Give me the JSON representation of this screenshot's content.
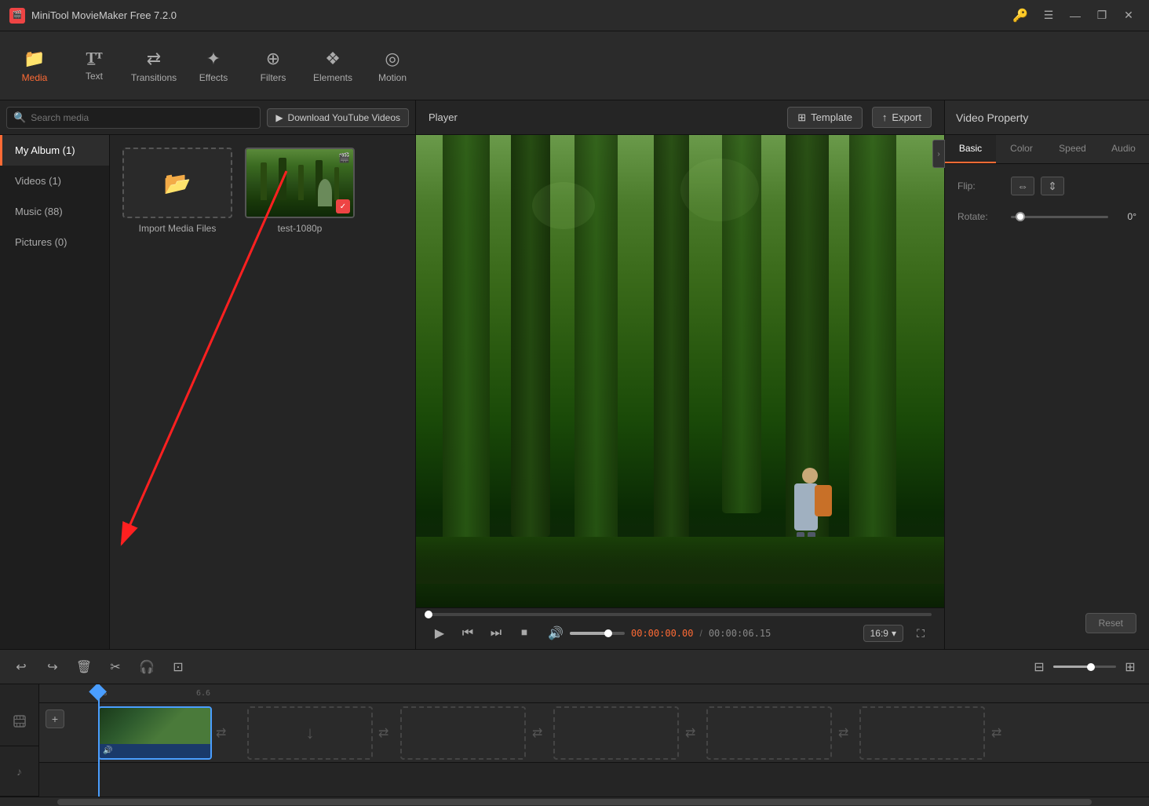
{
  "app": {
    "title": "MiniTool MovieMaker Free 7.2.0",
    "icon_label": "M"
  },
  "titlebar": {
    "title": "MiniTool MovieMaker Free 7.2.0",
    "win_minimize": "—",
    "win_restore": "❐",
    "win_close": "✕"
  },
  "toolbar": {
    "items": [
      {
        "id": "media",
        "icon": "📁",
        "label": "Media",
        "active": true
      },
      {
        "id": "text",
        "icon": "T",
        "label": "Text",
        "active": false
      },
      {
        "id": "transitions",
        "icon": "⇄",
        "label": "Transitions",
        "active": false
      },
      {
        "id": "effects",
        "icon": "✦",
        "label": "Effects",
        "active": false
      },
      {
        "id": "filters",
        "icon": "⊕",
        "label": "Filters",
        "active": false
      },
      {
        "id": "elements",
        "icon": "❖",
        "label": "Elements",
        "active": false
      },
      {
        "id": "motion",
        "icon": "◎",
        "label": "Motion",
        "active": false
      }
    ]
  },
  "left_panel": {
    "search_placeholder": "Search media",
    "download_btn": "Download YouTube Videos",
    "sidebar": {
      "items": [
        {
          "id": "my-album",
          "label": "My Album (1)",
          "active": true
        },
        {
          "id": "videos",
          "label": "Videos (1)",
          "active": false
        },
        {
          "id": "music",
          "label": "Music (88)",
          "active": false
        },
        {
          "id": "pictures",
          "label": "Pictures (0)",
          "active": false
        }
      ]
    },
    "media_items": [
      {
        "id": "import",
        "type": "import",
        "label": "Import Media Files"
      },
      {
        "id": "video1",
        "type": "video",
        "label": "test-1080p",
        "has_check": true
      }
    ]
  },
  "player": {
    "title": "Player",
    "template_btn": "Template",
    "export_btn": "Export",
    "time_current": "00:00:00.00",
    "time_separator": "/",
    "time_total": "00:00:06.15",
    "aspect_ratio": "16:9",
    "progress_pct": 0,
    "volume_pct": 70
  },
  "properties": {
    "title": "Video Property",
    "tabs": [
      {
        "id": "basic",
        "label": "Basic",
        "active": true
      },
      {
        "id": "color",
        "label": "Color",
        "active": false
      },
      {
        "id": "speed",
        "label": "Speed",
        "active": false
      },
      {
        "id": "audio",
        "label": "Audio",
        "active": false
      }
    ],
    "flip_label": "Flip:",
    "rotate_label": "Rotate:",
    "rotate_value": "0°",
    "rotate_pct": 10,
    "reset_btn": "Reset"
  },
  "timeline": {
    "undo_icon": "↩",
    "redo_icon": "↪",
    "delete_icon": "🗑",
    "cut_icon": "✂",
    "audio_icon": "🎧",
    "crop_icon": "⊡",
    "add_track_icon": "+",
    "ruler_marks": [
      "0s",
      "6.6"
    ],
    "zoom_pct": 60
  }
}
